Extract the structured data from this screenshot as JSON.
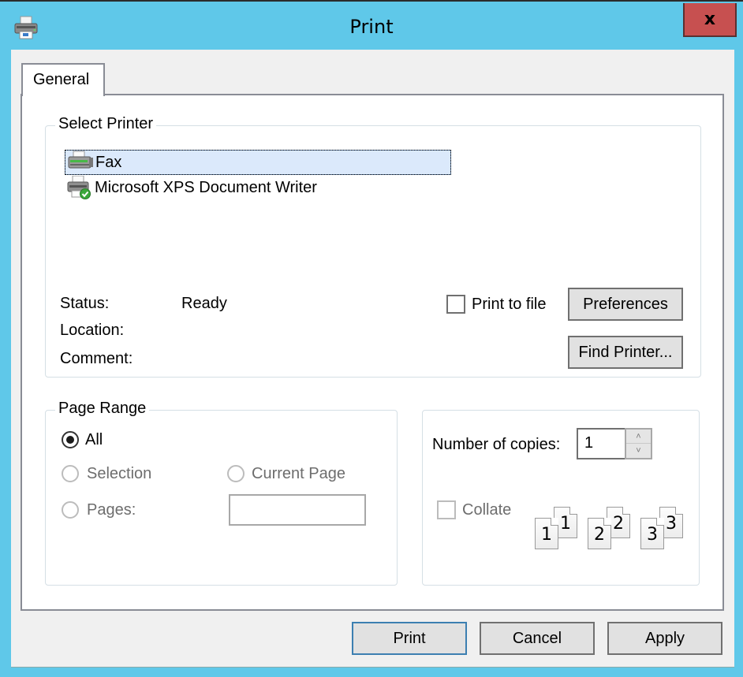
{
  "window": {
    "title": "Print",
    "close_label": "x",
    "icon": "printer-icon"
  },
  "tabs": [
    {
      "label": "General",
      "selected": true
    }
  ],
  "select_printer": {
    "group_label": "Select Printer",
    "printers": [
      {
        "name": "Fax",
        "icon": "fax-printer-icon",
        "selected": true
      },
      {
        "name": "Microsoft XPS Document Writer",
        "icon": "default-printer-icon",
        "selected": false,
        "is_default": true
      }
    ],
    "status_label": "Status:",
    "status_value": "Ready",
    "location_label": "Location:",
    "location_value": "",
    "comment_label": "Comment:",
    "comment_value": "",
    "print_to_file_label": "Print to file",
    "print_to_file_checked": false,
    "preferences_label": "Preferences",
    "find_printer_label": "Find Printer..."
  },
  "page_range": {
    "group_label": "Page Range",
    "options": {
      "all": {
        "label": "All",
        "checked": true,
        "enabled": true
      },
      "selection": {
        "label": "Selection",
        "checked": false,
        "enabled": false
      },
      "current_page": {
        "label": "Current Page",
        "checked": false,
        "enabled": false
      },
      "pages": {
        "label": "Pages:",
        "checked": false,
        "enabled": false
      }
    },
    "pages_value": ""
  },
  "copies": {
    "label": "Number of copies:",
    "value": "1",
    "collate_label": "Collate",
    "collate_checked": false,
    "collate_enabled": false,
    "collate_preview": [
      "1",
      "2",
      "3"
    ]
  },
  "footer": {
    "print_label": "Print",
    "cancel_label": "Cancel",
    "apply_label": "Apply"
  },
  "colors": {
    "titlebar": "#5fc8e9",
    "close_button": "#c75050",
    "selection_bg": "#dbe9fb",
    "default_button_border": "#3c7fb1"
  }
}
